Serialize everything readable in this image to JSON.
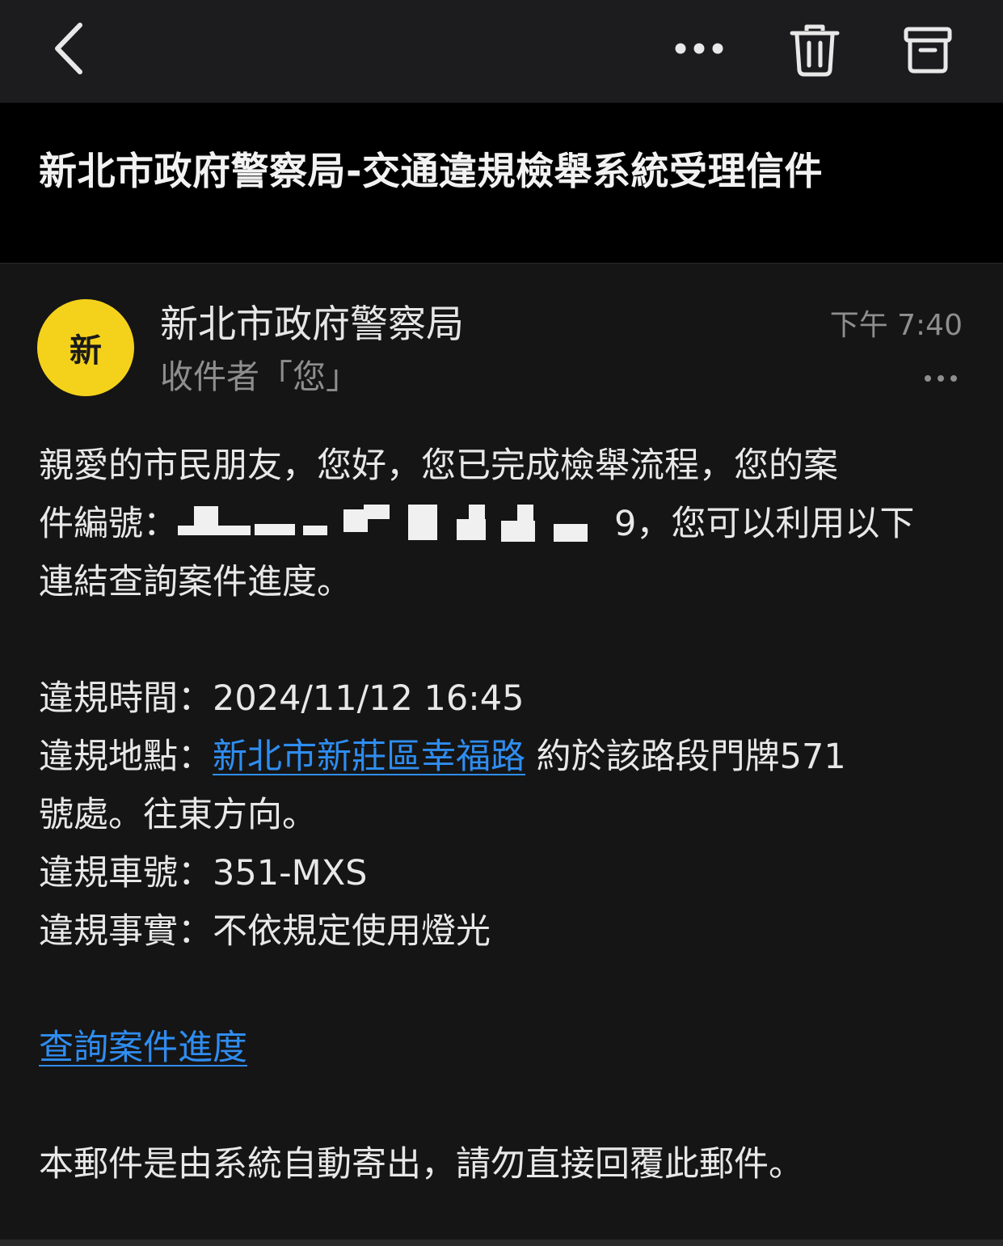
{
  "toolbar": {
    "back_icon": "chevron-left-icon",
    "more_icon": "ellipsis-icon",
    "delete_icon": "trash-icon",
    "archive_icon": "archive-icon"
  },
  "email": {
    "subject": "新北市政府警察局-交通違規檢舉系統受理信件",
    "sender_initial": "新",
    "sender_name": "新北市政府警察局",
    "recipient": "收件者「您」",
    "time": "下午 7:40",
    "avatar_color": "#f4d21c",
    "body": {
      "line1": "親愛的市民朋友，您好，您已完成檢舉流程，您的案",
      "line2_prefix": "件編號：",
      "case_number_suffix": "9，您可以利用以下",
      "line3": "連結查詢案件進度。",
      "time_label": "違規時間：",
      "time_value": "2024/11/12 16:45",
      "location_label": "違規地點：",
      "location_link": "新北市新莊區幸福路",
      "location_rest": " 約於該路段門牌571",
      "location_line2": "號處。往東方向。",
      "plate_label": "違規車號：",
      "plate_value": "351-MXS",
      "fact_label": "違規事實：",
      "fact_value": "不依規定使用燈光",
      "query_link": "查詢案件進度",
      "footer": "本郵件是由系統自動寄出，請勿直接回覆此郵件。"
    }
  },
  "colors": {
    "link": "#2f8df0",
    "toolbar_bg": "#1c1c1e",
    "content_bg": "#151515"
  }
}
